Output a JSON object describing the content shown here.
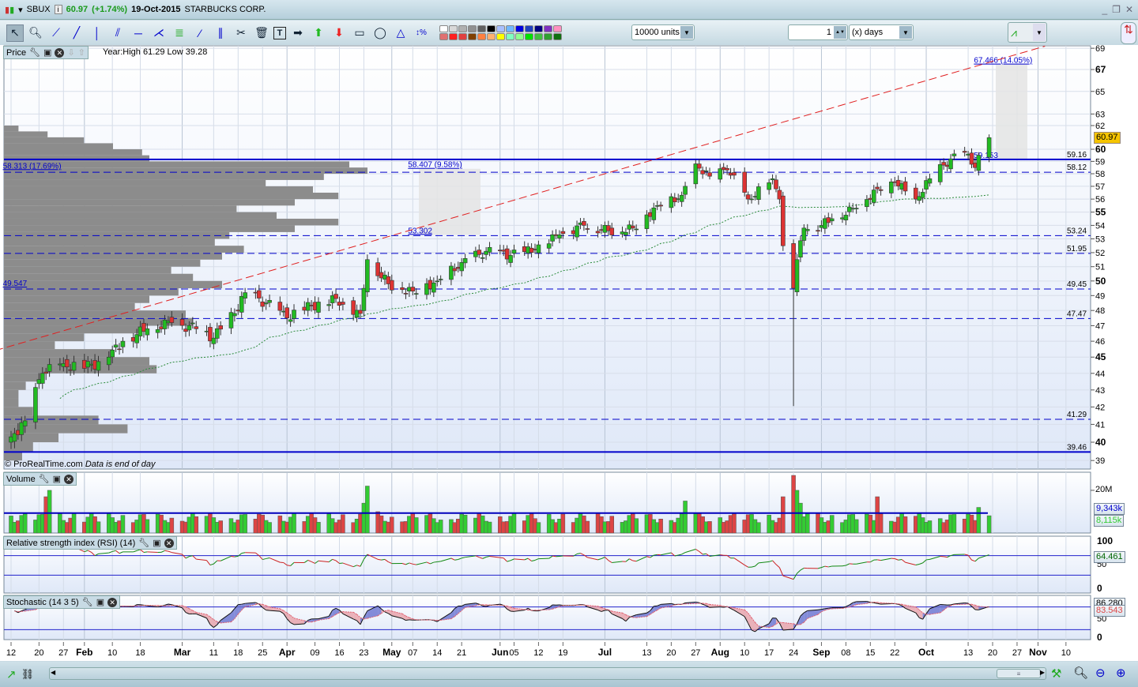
{
  "title": {
    "ticker": "SBUX",
    "price": "60.97",
    "change": "(+1.74%)",
    "date": "19-Oct-2015",
    "name": "STARBUCKS CORP."
  },
  "toolbar": {
    "tools": [
      "pointer-tool",
      "zoom-tool",
      "segment-tool",
      "line-tool",
      "vertical-line-tool",
      "channel-tool",
      "horizontal-line-tool",
      "fan-tool",
      "fibonacci-tool",
      "point-tool",
      "parallel-tool",
      "settings-tool",
      "delete-tool",
      "text-tool",
      "arrow-right-tool",
      "arrow-up-tool",
      "arrow-down-tool",
      "rectangle-tool",
      "ellipse-tool",
      "triangle-tool",
      "percent-tool"
    ],
    "palette_top": [
      "#ffffff",
      "#d8d8d8",
      "#b0b0b0",
      "#909090",
      "#606060",
      "#000000",
      "#a8c0ff",
      "#70b8ff",
      "#0000e0",
      "#2040c0",
      "#000080",
      "#8030c0",
      "#ff90c0"
    ],
    "palette_bottom": [
      "#e07070",
      "#ff2020",
      "#e04040",
      "#804000",
      "#ff8040",
      "#ffb070",
      "#ffff00",
      "#80ffc0",
      "#90ff90",
      "#00e000",
      "#40c040",
      "#30a030",
      "#107010"
    ],
    "units_value": "10000 units",
    "period_value": "1",
    "period_unit": "(x) days"
  },
  "price_panel": {
    "label": "Price",
    "info": "Year:High 61.29 Low 39.28",
    "copyright": "© ProRealTime.com",
    "note": "Data is end of day",
    "last_price": "60.97"
  },
  "volume_panel": {
    "label": "Volume",
    "axis_label": "20M",
    "ma_value": "9,343k",
    "value": "8,115k"
  },
  "rsi_panel": {
    "label": "Relative strength index (RSI) (14)",
    "axis": [
      "100",
      "50",
      "0"
    ],
    "value": "64.461"
  },
  "stoch_panel": {
    "label": "Stochastic (14 3 5)",
    "axis": [
      "50",
      "0"
    ],
    "k_value": "86.280",
    "d_value": "83.543"
  },
  "price_axis": [
    69,
    67,
    65,
    63,
    62,
    60,
    59,
    58,
    57,
    56,
    55,
    54,
    53,
    52,
    51,
    50,
    49,
    48,
    47,
    46,
    45,
    44,
    43,
    42,
    41,
    40,
    39
  ],
  "price_axis_bold": [
    67,
    60,
    55,
    50,
    45,
    40
  ],
  "levels": [
    {
      "price": 59.16,
      "label": "59.16",
      "style": "solid"
    },
    {
      "price": 58.12,
      "label": "58.12",
      "style": "dashed"
    },
    {
      "price": 53.24,
      "label": "53.24",
      "style": "dashed"
    },
    {
      "price": 51.95,
      "label": "51.95",
      "style": "dashed"
    },
    {
      "price": 49.45,
      "label": "49.45",
      "style": "dashed"
    },
    {
      "price": 47.47,
      "label": "47.47",
      "style": "dashed"
    },
    {
      "price": 41.29,
      "label": "41.29",
      "style": "dashed"
    },
    {
      "price": 39.46,
      "label": "39.46",
      "style": "solid"
    }
  ],
  "annotations": [
    {
      "label": "58.313 (17.69%)",
      "date": "01-11",
      "price": 58.3
    },
    {
      "label": "58.407 (9.58%)",
      "date": "05-07",
      "price": 58.4
    },
    {
      "label": "53.302",
      "date": "05-07",
      "price": 53.3
    },
    {
      "label": "49.547",
      "date": "01-11",
      "price": 49.55
    },
    {
      "label": "67.466 (14.05%)",
      "date": "10-16",
      "price": 67.47
    },
    {
      "label": "59.153",
      "date": "10-16",
      "price": 59.15
    }
  ],
  "date_axis": [
    {
      "date": "01-12",
      "label": "12"
    },
    {
      "date": "01-20",
      "label": "20"
    },
    {
      "date": "01-27",
      "label": "27"
    },
    {
      "date": "02-02",
      "label": "Feb",
      "bold": true
    },
    {
      "date": "02-10",
      "label": "10"
    },
    {
      "date": "02-18",
      "label": "18"
    },
    {
      "date": "03-02",
      "label": "Mar",
      "bold": true
    },
    {
      "date": "03-11",
      "label": "11"
    },
    {
      "date": "03-18",
      "label": "18"
    },
    {
      "date": "03-25",
      "label": "25"
    },
    {
      "date": "04-01",
      "label": "Apr",
      "bold": true
    },
    {
      "date": "04-09",
      "label": "09"
    },
    {
      "date": "04-16",
      "label": "16"
    },
    {
      "date": "04-23",
      "label": "23"
    },
    {
      "date": "05-01",
      "label": "May",
      "bold": true
    },
    {
      "date": "05-07",
      "label": "07"
    },
    {
      "date": "05-14",
      "label": "14"
    },
    {
      "date": "05-21",
      "label": "21"
    },
    {
      "date": "06-01",
      "label": "Jun",
      "bold": true
    },
    {
      "date": "06-05",
      "label": "05"
    },
    {
      "date": "06-12",
      "label": "12"
    },
    {
      "date": "06-19",
      "label": "19"
    },
    {
      "date": "07-01",
      "label": "Jul",
      "bold": true
    },
    {
      "date": "07-13",
      "label": "13"
    },
    {
      "date": "07-20",
      "label": "20"
    },
    {
      "date": "07-27",
      "label": "27"
    },
    {
      "date": "08-03",
      "label": "Aug",
      "bold": true
    },
    {
      "date": "08-10",
      "label": "10"
    },
    {
      "date": "08-17",
      "label": "17"
    },
    {
      "date": "08-24",
      "label": "24"
    },
    {
      "date": "09-01",
      "label": "Sep",
      "bold": true
    },
    {
      "date": "09-08",
      "label": "08"
    },
    {
      "date": "09-15",
      "label": "15"
    },
    {
      "date": "09-22",
      "label": "22"
    },
    {
      "date": "10-01",
      "label": "Oct",
      "bold": true
    },
    {
      "date": "10-13",
      "label": "13"
    },
    {
      "date": "10-20",
      "label": "20"
    },
    {
      "date": "10-27",
      "label": "27"
    },
    {
      "date": "11-02",
      "label": "Nov",
      "bold": true
    },
    {
      "date": "11-10",
      "label": "10"
    }
  ],
  "chart_data": {
    "type": "candlestick",
    "closes": [
      [
        "01-12",
        40.3
      ],
      [
        "01-16",
        41.2
      ],
      [
        "01-21",
        44.0
      ],
      [
        "01-27",
        44.6
      ],
      [
        "02-02",
        44.3
      ],
      [
        "02-09",
        45.0
      ],
      [
        "02-13",
        46.0
      ],
      [
        "02-20",
        46.8
      ],
      [
        "02-27",
        47.2
      ],
      [
        "03-06",
        46.8
      ],
      [
        "03-11",
        46.2
      ],
      [
        "03-17",
        47.8
      ],
      [
        "03-20",
        49.2
      ],
      [
        "03-26",
        48.5
      ],
      [
        "04-01",
        47.5
      ],
      [
        "04-08",
        48.3
      ],
      [
        "04-15",
        48.8
      ],
      [
        "04-22",
        47.8
      ],
      [
        "04-24",
        51.5
      ],
      [
        "04-30",
        49.8
      ],
      [
        "05-07",
        49.3
      ],
      [
        "05-14",
        50.0
      ],
      [
        "05-21",
        51.3
      ],
      [
        "05-28",
        52.1
      ],
      [
        "06-04",
        51.8
      ],
      [
        "06-11",
        52.2
      ],
      [
        "06-18",
        53.3
      ],
      [
        "06-25",
        54.0
      ],
      [
        "07-02",
        53.6
      ],
      [
        "07-09",
        53.8
      ],
      [
        "07-16",
        55.5
      ],
      [
        "07-23",
        56.3
      ],
      [
        "07-27",
        58.8
      ],
      [
        "07-31",
        57.8
      ],
      [
        "08-05",
        58.3
      ],
      [
        "08-11",
        56.0
      ],
      [
        "08-18",
        57.6
      ],
      [
        "08-20",
        56.0
      ],
      [
        "08-21",
        52.5
      ],
      [
        "08-24",
        49.5
      ],
      [
        "08-25",
        51.5
      ],
      [
        "08-27",
        53.8
      ],
      [
        "09-01",
        54.0
      ],
      [
        "09-04",
        54.5
      ],
      [
        "09-11",
        55.3
      ],
      [
        "09-17",
        56.8
      ],
      [
        "09-22",
        57.3
      ],
      [
        "09-28",
        56.0
      ],
      [
        "10-02",
        57.6
      ],
      [
        "10-08",
        59.2
      ],
      [
        "10-13",
        59.6
      ],
      [
        "10-15",
        58.5
      ],
      [
        "10-16",
        59.5
      ],
      [
        "10-19",
        60.97
      ]
    ],
    "low_overrides": [
      [
        "08-24",
        42.05
      ]
    ],
    "volume_m": [
      [
        "01-12",
        8
      ],
      [
        "01-22",
        17
      ],
      [
        "01-23",
        20
      ],
      [
        "01-26",
        9
      ],
      [
        "04-23",
        14
      ],
      [
        "04-24",
        22
      ],
      [
        "04-27",
        10
      ],
      [
        "07-24",
        15
      ],
      [
        "07-27",
        9
      ],
      [
        "08-21",
        17
      ],
      [
        "08-24",
        27
      ],
      [
        "08-25",
        20
      ],
      [
        "08-26",
        14
      ],
      [
        "08-28",
        9
      ],
      [
        "09-17",
        17
      ],
      [
        "09-18",
        9
      ],
      [
        "10-16",
        12
      ],
      [
        "10-19",
        8.1
      ]
    ],
    "volume_base_m": 7,
    "volume_ma_m": 9.343,
    "profile_start": 39,
    "profile_step": 0.5,
    "volume_profile": [
      5,
      8,
      15,
      34,
      26,
      8,
      4,
      4,
      6,
      10,
      42,
      40,
      30,
      14,
      22,
      38,
      52,
      50,
      36,
      40,
      48,
      60,
      52,
      46,
      54,
      60,
      66,
      58,
      62,
      80,
      92,
      75,
      64,
      80,
      92,
      85,
      72,
      88,
      100,
      95,
      40,
      38,
      30,
      22,
      12,
      4
    ],
    "trendline": [
      [
        "01-01",
        45.0
      ],
      [
        "11-04",
        69.2
      ]
    ],
    "ma_period": 50,
    "rsi_levels": [
      70,
      30
    ],
    "stoch_levels": [
      80,
      20
    ]
  },
  "bottombar": {
    "tools": [
      "chart-type-icon",
      "link-icon",
      "scroll-left",
      "scroll-right",
      "candle-settings-icon",
      "auto-zoom-icon",
      "zoom-out-icon",
      "zoom-in-icon"
    ]
  }
}
